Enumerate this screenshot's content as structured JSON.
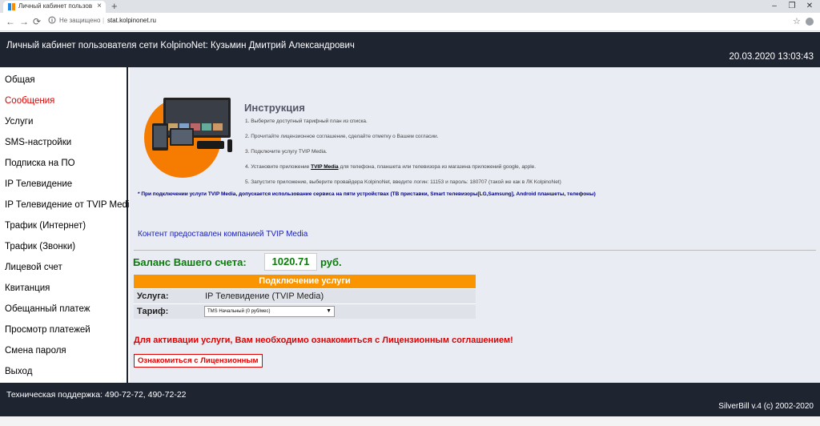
{
  "browser": {
    "tab_title": "Личный кабинет пользовател",
    "tab_close": "×",
    "new_tab": "+",
    "window_minimize": "–",
    "window_restore": "❐",
    "window_close": "✕",
    "back": "←",
    "forward": "→",
    "reload": "⟳",
    "insecure_label": "Не защищено",
    "url_sep": "|",
    "url": "stat.kolpinonet.ru",
    "bookmark": "☆"
  },
  "header": {
    "title": "Личный кабинет пользователя сети KolpinoNet: Кузьмин Дмитрий Александрович",
    "datetime": "20.03.2020 13:03:43"
  },
  "sidebar": {
    "items": [
      {
        "label": "Общая",
        "active": false
      },
      {
        "label": "Сообщения",
        "active": true
      },
      {
        "label": "Услуги",
        "active": false
      },
      {
        "label": "SMS-настройки",
        "active": false
      },
      {
        "label": "Подписка на ПО",
        "active": false
      },
      {
        "label": "IP Телевидение",
        "active": false
      },
      {
        "label": "IP Телевидение от TVIP Media",
        "active": false
      },
      {
        "label": "Трафик (Интернет)",
        "active": false
      },
      {
        "label": "Трафик (Звонки)",
        "active": false
      },
      {
        "label": "Лицевой счет",
        "active": false
      },
      {
        "label": "Квитанция",
        "active": false
      },
      {
        "label": "Обещанный платеж",
        "active": false
      },
      {
        "label": "Просмотр платежей",
        "active": false
      },
      {
        "label": "Смена пароля",
        "active": false
      },
      {
        "label": "Выход",
        "active": false
      }
    ]
  },
  "instruction": {
    "title": "Инструкция",
    "step1": "1. Выберите доступный тарифный план из списка.",
    "step2": "2. Прочитайте лицензионное соглашение, сделайте отметку о Вашем согласии.",
    "step3": "3. Подключите услугу TVIP Media.",
    "step4_pre": "4. Установите приложение ",
    "step4_link": "TVIP Media",
    "step4_post": " для телефона, планшета или телевизора из магазина приложений google, apple.",
    "step5": "5. Запустите приложение, выберите провайдера KolpinoNet, введите логин: 11153 и пароль: 180707 (такой же как в ЛК KolpinoNet)",
    "note": "* При подключении услуги TVIP Media, допускается использование сервиса на пяти устройствах (ТВ приставки, Smart телевизоры[LG,Samsung], Android планшеты, телефоны)"
  },
  "content_link": "Контент предоставлен компанией TVIP Media",
  "balance": {
    "label": "Баланс Вашего счета:",
    "value": "1020.71",
    "unit": "руб."
  },
  "service": {
    "header": "Подключение услуги",
    "service_label": "Услуга:",
    "service_value": "IP Телевидение (TVIP Media)",
    "tariff_label": "Тариф:",
    "tariff_selected": "TMS Начальный (0 руб/мес)"
  },
  "warning": "Для активации услуги, Вам необходимо ознакомиться с Лицензионным соглашением!",
  "license_button": "Ознакомиться с Лицензионным",
  "footer": {
    "support": "Техническая поддержка: 490-72-72, 490-72-22",
    "version": "SilverBill v.4 (c) 2002-2020"
  },
  "colors": {
    "dark_bar": "#1f2431",
    "accent_orange": "#fa9500",
    "balance_green": "#0a7d0a",
    "alert_red": "#e00000",
    "link_blue": "#1a22b8"
  }
}
